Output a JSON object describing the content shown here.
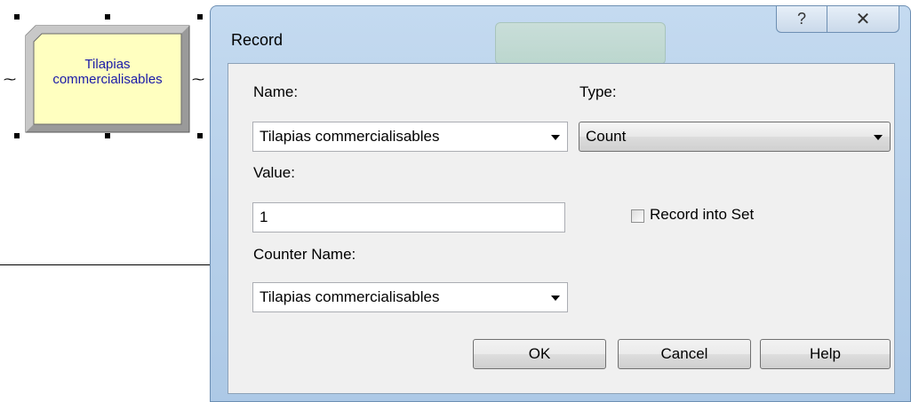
{
  "canvas": {
    "module": {
      "label_line1": "Tilapias",
      "label_line2": "commercialisables"
    }
  },
  "dialog": {
    "title": "Record",
    "help_button_glyph": "?",
    "close_button_glyph": "✕",
    "name": {
      "label": "Name:",
      "value": "Tilapias commercialisables"
    },
    "type": {
      "label": "Type:",
      "value": "Count"
    },
    "value": {
      "label": "Value:",
      "value": "1"
    },
    "record_into_set": {
      "label": "Record into Set",
      "checked": false
    },
    "counter_name": {
      "label": "Counter Name:",
      "value": "Tilapias commercialisables"
    },
    "buttons": {
      "ok": "OK",
      "cancel": "Cancel",
      "help": "Help"
    }
  },
  "colors": {
    "module_fill": "#ffffc0",
    "module_text": "#1a1aa8",
    "dialog_frame": "#b7d0ea",
    "client_bg": "#f0f0f0"
  },
  "icons": {
    "help": "question-mark-icon",
    "close": "close-icon",
    "dropdown": "chevron-down-icon"
  }
}
